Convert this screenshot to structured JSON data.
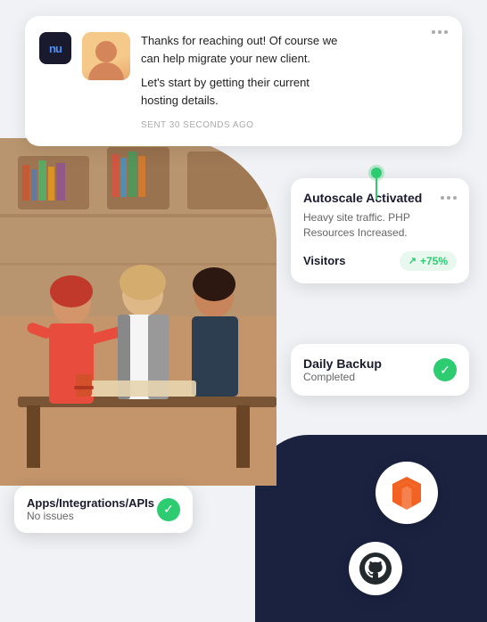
{
  "chat": {
    "logo_text": "nu",
    "message_line1": "Thanks for reaching out! Of course we",
    "message_line2": "can help migrate your new client.",
    "message_line3": "Let's start by getting their current",
    "message_line4": "hosting details.",
    "timestamp": "SENT 30 SECONDS AGO",
    "more_icon": "···"
  },
  "autoscale": {
    "title": "Autoscale Activated",
    "description": "Heavy site traffic. PHP Resources Increased.",
    "visitors_label": "Visitors",
    "visitors_badge": "+75%",
    "more_icon": "···"
  },
  "backup": {
    "title": "Daily Backup",
    "status": "Completed",
    "check_icon": "✓"
  },
  "apps": {
    "title": "Apps/Integrations/APIs",
    "status": "No issues",
    "check_icon": "✓"
  },
  "connector": {
    "dot_color": "#2ecc71"
  },
  "icons": {
    "magento_color": "#f26322",
    "github_color": "#24292e",
    "check_color": "#2ecc71"
  }
}
